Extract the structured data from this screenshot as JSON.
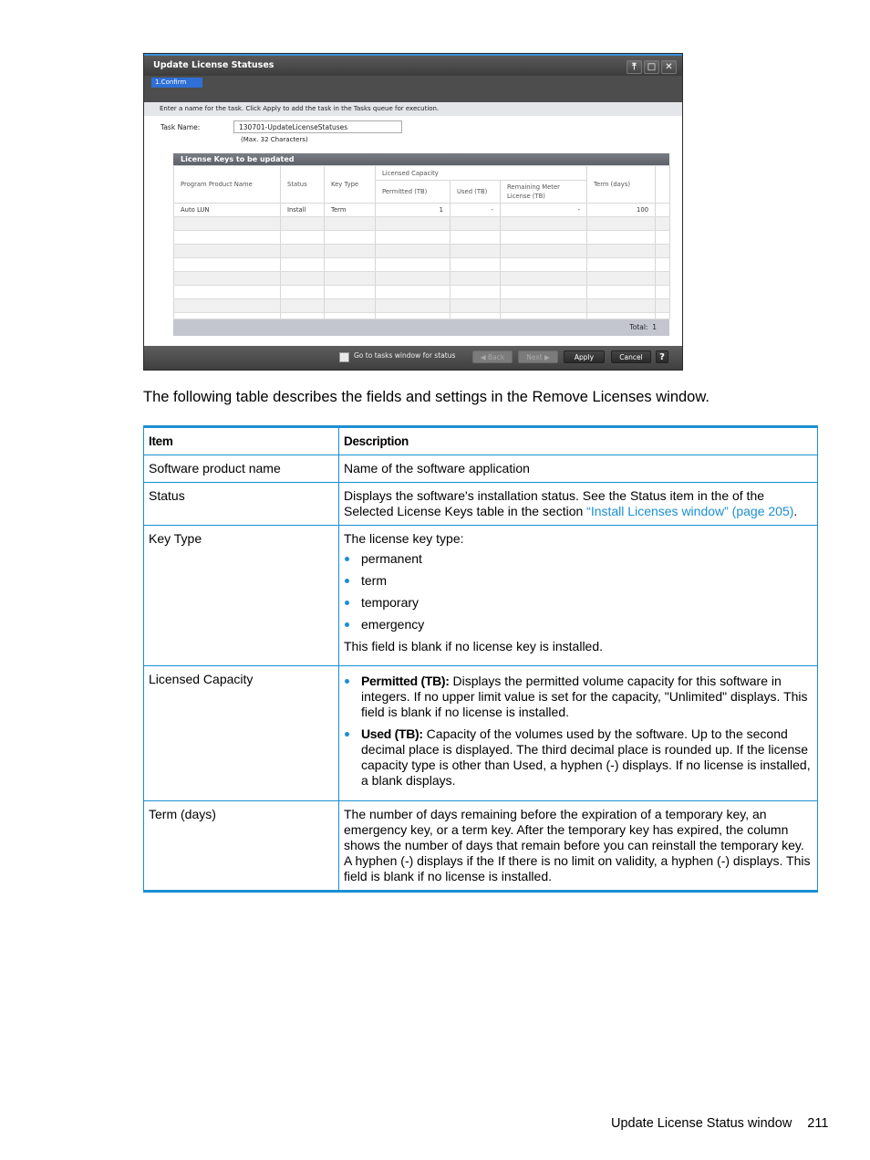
{
  "dialog": {
    "title": "Update License Statuses",
    "window_buttons": [
      "pin-icon",
      "maximize-icon",
      "close-icon"
    ],
    "step": "1.Confirm",
    "instruction": "Enter a name for the task. Click Apply to add the task in the Tasks queue for execution.",
    "task_name_label": "Task Name:",
    "task_name_value": "130701-UpdateLicenseStatuses",
    "task_name_hint": "(Max. 32 Characters)",
    "grid": {
      "caption": "License Keys to be updated",
      "headers": {
        "program_product_name": "Program Product Name",
        "status": "Status",
        "key_type": "Key Type",
        "licensed_capacity": "Licensed Capacity",
        "permitted": "Permitted (TB)",
        "used": "Used (TB)",
        "remaining": "Remaining Meter License (TB)",
        "term": "Term (days)"
      },
      "rows": [
        {
          "name": "Auto LUN",
          "status": "Install",
          "key_type": "Term",
          "permitted": "1",
          "used": "-",
          "remaining": "-",
          "term": "100"
        }
      ],
      "total_label": "Total:",
      "total_value": "1"
    },
    "footer": {
      "checkbox_label": "Go to tasks window for status",
      "back_label": "◀ Back",
      "next_label": "Next ▶",
      "apply_label": "Apply",
      "cancel_label": "Cancel",
      "help_label": "?"
    }
  },
  "intro_text": "The following table describes the fields and settings in the Remove Licenses window.",
  "table": {
    "headers": {
      "item": "Item",
      "description": "Description"
    },
    "rows": {
      "software": {
        "item": "Software product name",
        "description": "Name of the software application"
      },
      "status": {
        "item": "Status",
        "description_pre": "Displays the software's installation status. See the Status item in the of the Selected License Keys table in the section ",
        "link": "“Install Licenses window” (page 205)",
        "description_post": "."
      },
      "key_type": {
        "item": "Key Type",
        "intro": "The license key type:",
        "bullets": [
          "permanent",
          "term",
          "temporary",
          "emergency"
        ],
        "outro": "This field is blank if no license key is installed."
      },
      "licensed_capacity": {
        "item": "Licensed Capacity",
        "bullets": [
          {
            "label": "Permitted (TB):",
            "text": " Displays the permitted volume capacity for this software in integers. If no upper limit value is set for the capacity, \"Unlimited\" displays. This field is blank if no license is installed."
          },
          {
            "label": "Used (TB):",
            "text": " Capacity of the volumes used by the software. Up to the second decimal place is displayed. The third decimal place is rounded up. If the license capacity type is other than Used, a hyphen (-) displays. If no license is installed, a blank displays."
          }
        ]
      },
      "term": {
        "item": "Term (days)",
        "description": "The number of days remaining before the expiration of a temporary key, an emergency key, or a term key. After the temporary key has expired, the column shows the number of days that remain before you can reinstall the temporary key. A hyphen (-) displays if the If there is no limit on validity, a hyphen (-) displays. This field is blank if no license is installed."
      }
    }
  },
  "page_footer": {
    "section": "Update License Status window",
    "page_number": "211"
  },
  "colors": {
    "accent": "#1b8fd2",
    "step_badge": "#2f6fd6"
  }
}
